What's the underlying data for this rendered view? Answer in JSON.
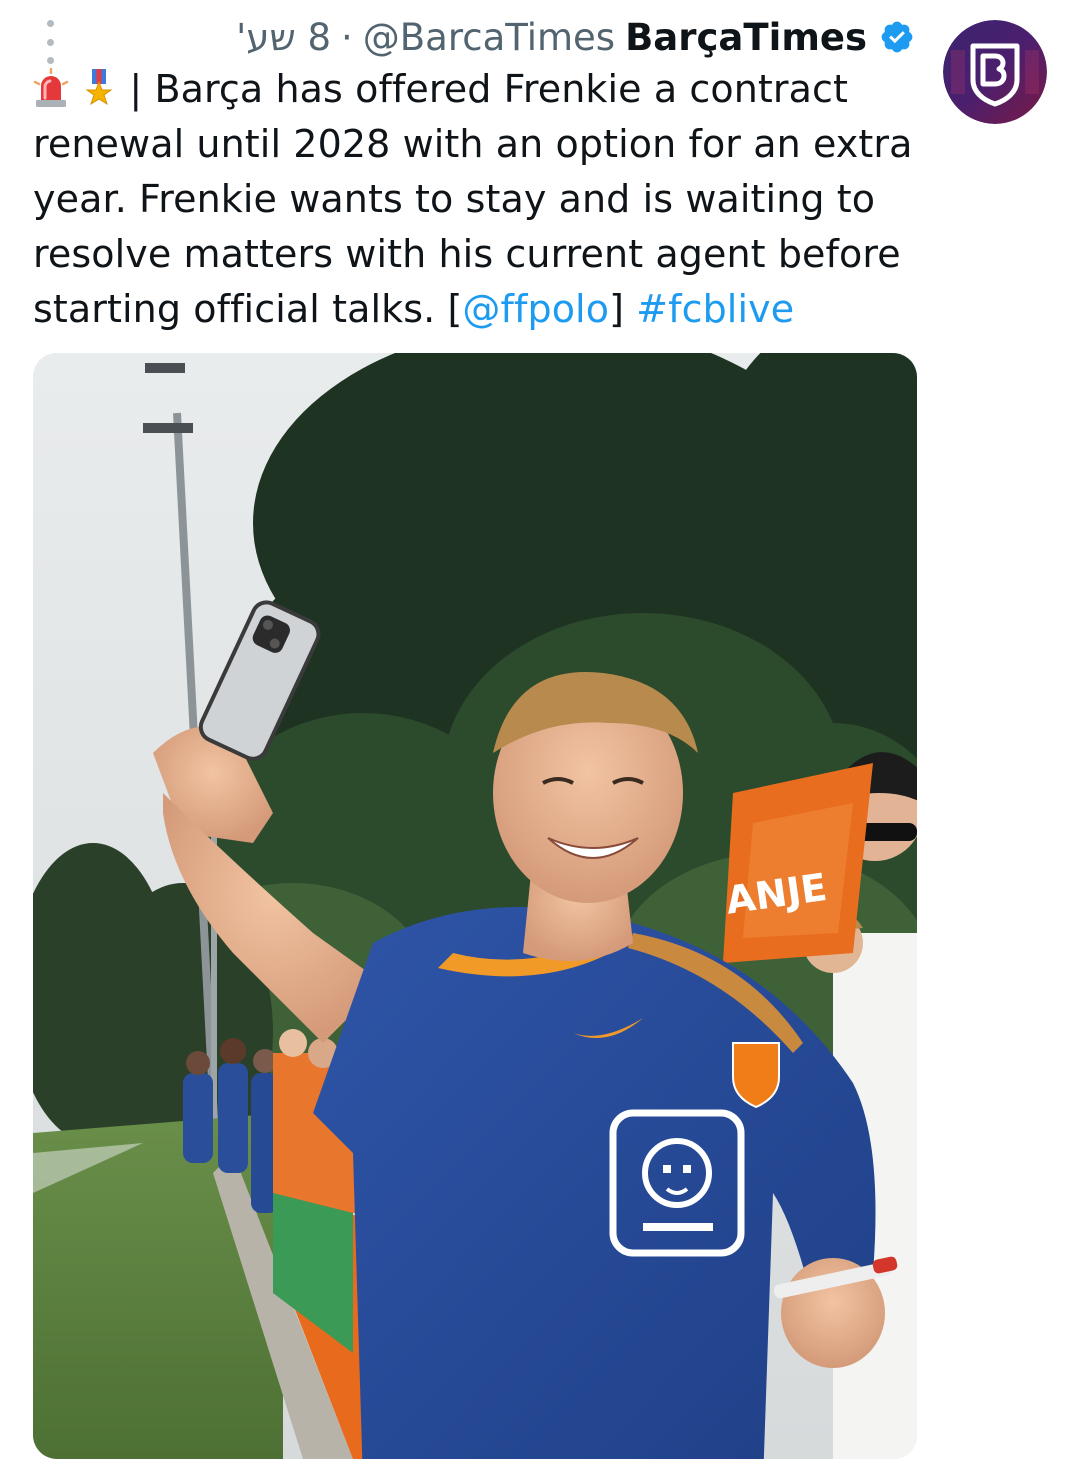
{
  "header": {
    "display_name": "BarçaTimes",
    "handle": "@BarcaTimes",
    "separator": "·",
    "time": "8 שע'"
  },
  "tweet": {
    "text_part1": " | Barça has offered Frenkie a contract renewal until 2028 with an option for an extra year. Frenkie wants to stay and is waiting to resolve matters with his current agent before starting official talks. [",
    "mention": "@ffpolo",
    "text_part2": "] ",
    "hashtag": "#fcblive",
    "emojis": [
      "police-light-emoji",
      "military-medal-emoji"
    ]
  },
  "media": {
    "kind": "photo",
    "photo_banner_text": "ANJE"
  },
  "colors": {
    "link": "#1d9bf0",
    "verified": "#1d9bf0",
    "secondary_text": "#536471",
    "avatar_bg": "#2a1b5e"
  },
  "icons": {
    "more": "more-icon",
    "verified": "verified-badge-icon",
    "avatar": "barcatimes-logo"
  }
}
